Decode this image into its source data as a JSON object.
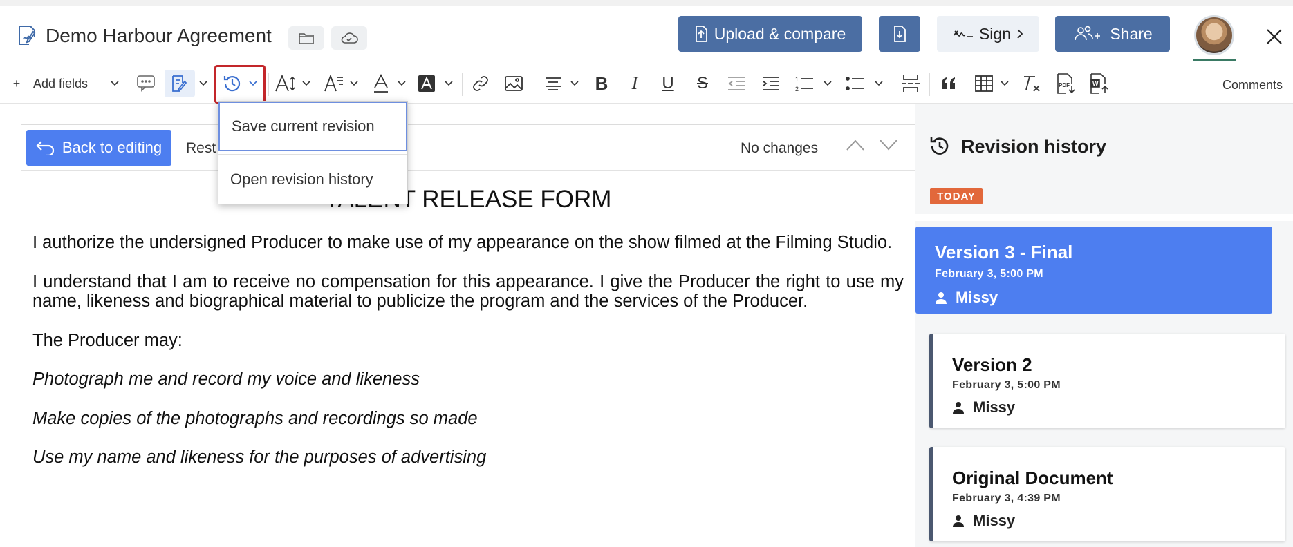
{
  "header": {
    "doc_title": "Demo Harbour Agreement",
    "upload_label": "Upload & compare",
    "sign_label": "Sign",
    "share_label": "Share",
    "icons": [
      "edit-document-icon",
      "folder-icon",
      "cloud-icon",
      "download-icon",
      "signature-icon",
      "chevron-right-icon",
      "add-users-icon",
      "close-icon"
    ]
  },
  "toolbar": {
    "add_fields_label": "Add fields",
    "comments_label": "Comments"
  },
  "revision_menu": {
    "save_label": "Save current revision",
    "open_label": "Open revision history"
  },
  "doc_bar": {
    "back_label": "Back to editing",
    "restore_label": "Rest",
    "status_label": "No changes"
  },
  "document": {
    "heading": "TALENT RELEASE FORM",
    "para1": "I authorize the undersigned Producer to make use of my appearance on the show filmed at the Filming Studio.",
    "para2": "I understand that I am to receive no compensation for this appearance. I give the Producer the right to use my name, likeness and biographical material to publicize the program and the services of the Producer.",
    "para3": "The Producer may:",
    "item1": "Photograph me and record my voice and likeness",
    "item2": "Make copies of the photographs and recordings so made",
    "item3": "Use my name and likeness for the purposes of advertising"
  },
  "revision_panel": {
    "title": "Revision history",
    "today_badge": "TODAY",
    "versions": [
      {
        "title": "Version 3 - Final",
        "date": "February 3, 5:00 PM",
        "user": "Missy",
        "active": true
      },
      {
        "title": "Version 2",
        "date": "February 3, 5:00 PM",
        "user": "Missy",
        "active": false
      },
      {
        "title": "Original Document",
        "date": "February 3, 4:39 PM",
        "user": "Missy",
        "active": false
      }
    ]
  },
  "colors": {
    "primary_button": "#4b6ea3",
    "accent_blue": "#4d7ef0",
    "today_badge": "#e2683b",
    "highlight_red": "#c3262a"
  }
}
